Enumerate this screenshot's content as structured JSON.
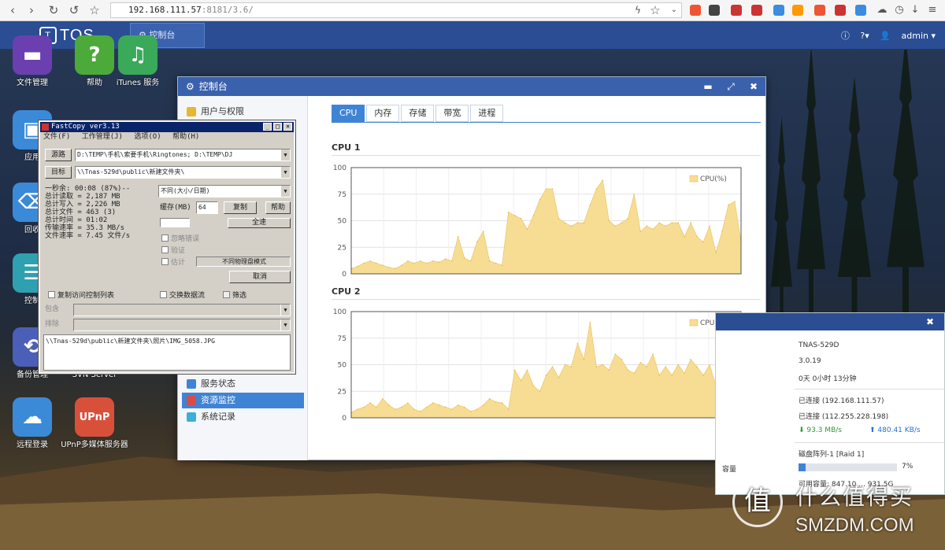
{
  "browser": {
    "url_host": "192.168.111.57",
    "url_path": ":8181/3.6/"
  },
  "topbar": {
    "logo_text": "TOS",
    "task_label": "控制台",
    "user": "admin"
  },
  "desktop_icons": [
    {
      "label": "文件管理",
      "color": "#6b3fb0",
      "icon": "monitor-icon"
    },
    {
      "label": "帮助",
      "color": "#4caa3a",
      "icon": "question-icon"
    },
    {
      "label": "iTunes 服务",
      "color": "#3aa95a",
      "icon": "music-icon"
    },
    {
      "label": "应用",
      "color": "#3b8ad8",
      "icon": "app-icon"
    },
    {
      "label": "回收",
      "color": "#3b8ad8",
      "icon": "trash-icon"
    },
    {
      "label": "控制",
      "color": "#2fa0b0",
      "icon": "sliders-icon"
    },
    {
      "label": "备份管理",
      "color": "#4b5fb8",
      "icon": "backup-icon"
    },
    {
      "label": "SVN Server",
      "color": "#2a6fb0",
      "icon": "svn-icon"
    },
    {
      "label": "远程登录",
      "color": "#3b8ad8",
      "icon": "cloud-icon"
    },
    {
      "label": "UPnP多媒体服务器",
      "color": "#d9503a",
      "icon": "upnp-icon"
    }
  ],
  "control_panel": {
    "title": "控制台",
    "side_items": [
      {
        "label": "用户与权限",
        "selected": false,
        "color": "#e6b830"
      },
      {
        "label": "服务状态",
        "selected": false,
        "color": "#3f84d4"
      },
      {
        "label": "资源监控",
        "selected": true,
        "color": "#d94b4b"
      },
      {
        "label": "系统记录",
        "selected": false,
        "color": "#3fb0d4"
      }
    ],
    "tabs": [
      "CPU",
      "内存",
      "存储",
      "带宽",
      "进程"
    ],
    "active_tab": "CPU"
  },
  "chart_data": [
    {
      "type": "area",
      "title": "CPU 1",
      "series": [
        {
          "name": "CPU(%)",
          "color": "#f7dc94",
          "values": [
            5,
            7,
            10,
            12,
            10,
            8,
            6,
            5,
            8,
            12,
            10,
            12,
            10,
            12,
            11,
            14,
            12,
            35,
            15,
            12,
            30,
            40,
            12,
            10,
            8,
            58,
            55,
            52,
            42,
            55,
            70,
            80,
            80,
            52,
            48,
            45,
            48,
            48,
            65,
            80,
            88,
            50,
            45,
            48,
            52,
            75,
            40,
            45,
            42,
            48,
            45,
            48,
            48,
            35,
            48,
            35,
            30,
            45,
            20,
            40,
            65,
            68,
            30
          ]
        }
      ],
      "ylim": [
        0,
        100
      ],
      "yticks": [
        0,
        25,
        50,
        75,
        100
      ],
      "grid": true,
      "legend": "top-right"
    },
    {
      "type": "area",
      "title": "CPU 2",
      "series": [
        {
          "name": "CPU(%)",
          "color": "#f7dc94",
          "values": [
            5,
            8,
            10,
            14,
            10,
            18,
            12,
            8,
            10,
            14,
            8,
            6,
            10,
            14,
            12,
            10,
            8,
            12,
            10,
            6,
            8,
            12,
            18,
            15,
            14,
            8,
            45,
            35,
            45,
            30,
            25,
            40,
            48,
            38,
            50,
            48,
            70,
            55,
            90,
            48,
            50,
            45,
            60,
            55,
            45,
            42,
            52,
            48,
            60,
            40,
            48,
            40,
            50,
            42,
            55,
            48,
            40,
            50,
            30,
            48,
            62,
            30,
            30
          ]
        }
      ],
      "ylim": [
        0,
        100
      ],
      "yticks": [
        0,
        25,
        50,
        75,
        100
      ],
      "grid": true,
      "legend": "top-right"
    }
  ],
  "fastcopy": {
    "title": "FastCopy ver3.13",
    "menu": [
      "文件(F)",
      "工作管理(J)",
      "选项(O)",
      "帮助(H)"
    ],
    "source_btn": "源路",
    "source_val": "D:\\TEMP\\手机\\索要手机\\Ringtones; D:\\TEMP\\DJ",
    "dest_btn": "目标",
    "dest_val": "\\\\Tnas-529d\\public\\新建文件夹\\",
    "mode": "不同(大小/日期)",
    "buffer_label": "缓存(MB)",
    "buffer_val": "64",
    "execute_btn": "复制",
    "help_btn": "帮助",
    "all_btn": "全速",
    "stats": [
      "一秒余: 00:08 (87%)--",
      "总计读取 = 2,187 MB",
      "总计写入 = 2,226 MB",
      "总计文件 = 463 (3)",
      "总计时间 = 01:02",
      "传输速率 = 35.3 MB/s",
      "文件速率 = 7.45 文件/s"
    ],
    "opt1": "忽略错误",
    "opt2": "验证",
    "opt3": "估计",
    "disk_mode": "不同物理盘模式",
    "cancel_btn": "取消",
    "acl_chk": "复制访问控制列表",
    "stream_chk": "交换数据流",
    "filter_chk": "筛选",
    "include_label": "包含",
    "exclude_label": "排除",
    "status_path": "\\\\Tnas-529d\\public\\新建文件夹\\照片\\IMG_5058.JPG"
  },
  "sysinfo": {
    "model": "TNAS-529D",
    "version": "3.0.19",
    "uptime": "0天 0小时 13分钟",
    "conn1": "已连接 (192.168.111.57)",
    "conn2": "已连接 (112.255.228.198)",
    "down_speed": "93.3 MB/s",
    "up_speed": "480.41 KB/s",
    "raid": "磁盘阵列-1 [Raid 1]",
    "capacity_label": "容量",
    "usage_pct_text": "7%",
    "usage_fraction": 0.07,
    "avail": "可用容量: 847.10 ... 931.5G"
  },
  "watermark": {
    "glyph": "值",
    "cn": "什么值得买",
    "en": "SMZDM.COM"
  }
}
